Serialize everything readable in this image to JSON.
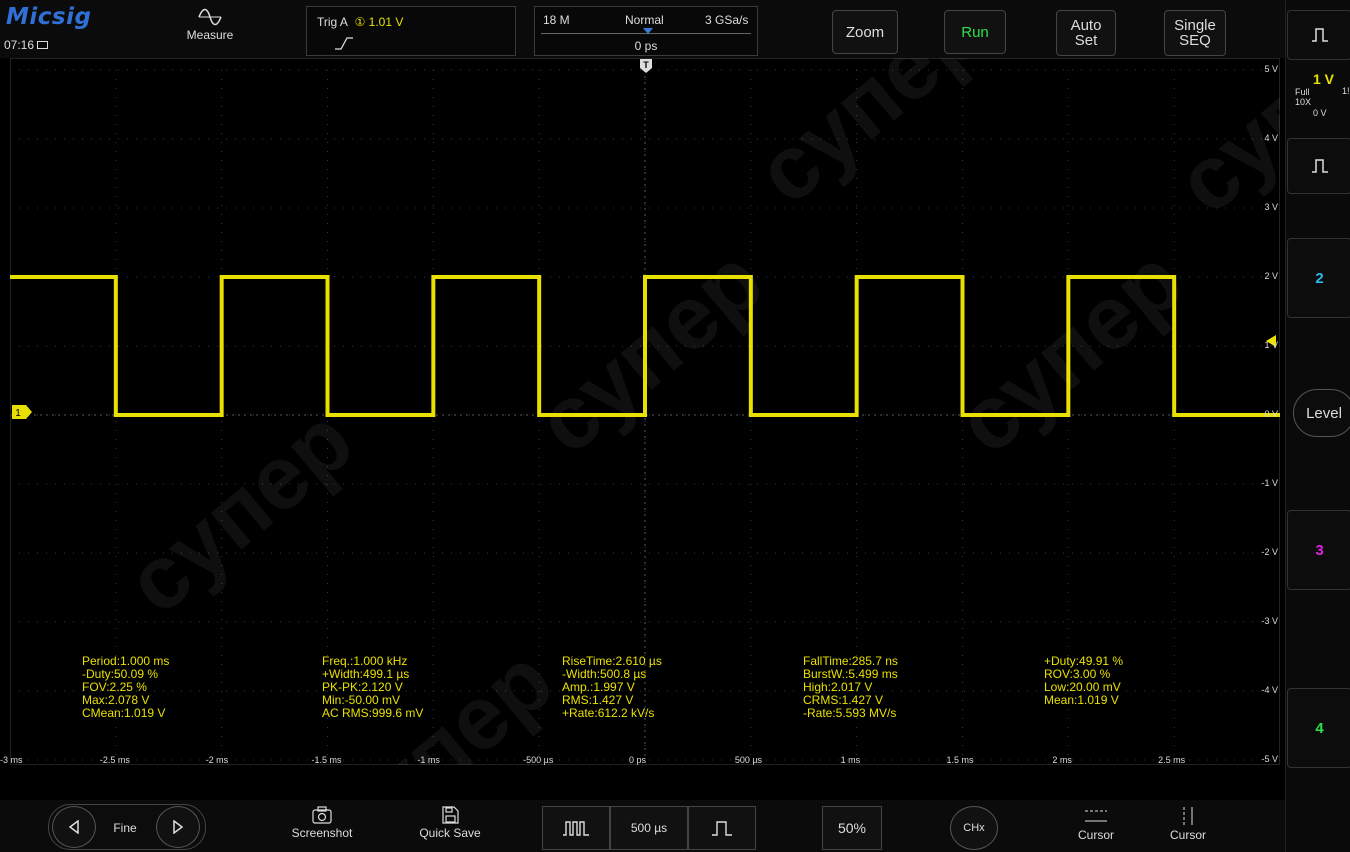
{
  "header": {
    "logo": "Micsig",
    "clock": "07:16",
    "measure_label": "Measure",
    "trigger": {
      "prefix": "Trig A",
      "channel_level": "① 1.01 V"
    },
    "acquisition": {
      "memory": "18 M",
      "mode": "Normal",
      "sample_rate": "3 GSa/s",
      "position": "0 ps"
    },
    "buttons": {
      "zoom": "Zoom",
      "run": "Run",
      "autoset_line1": "Auto",
      "autoset_line2": "Set",
      "single_line1": "Single",
      "single_line2": "SEQ"
    }
  },
  "scope": {
    "y_labels": [
      "5 V",
      "4 V",
      "3 V",
      "2 V",
      "1 V",
      "0 V",
      "-1 V",
      "-2 V",
      "-3 V",
      "-4 V",
      "-5 V"
    ],
    "x_labels": [
      "-3 ms",
      "-2.5 ms",
      "-2 ms",
      "-1.5 ms",
      "-1 ms",
      "-500 µs",
      "0 ps",
      "500 µs",
      "1 ms",
      "1.5 ms",
      "2 ms",
      "2.5 ms"
    ],
    "channel_marker": "1",
    "trigger_marker": "T",
    "waveform": {
      "period_ms": 1.0,
      "high_v": 2.0,
      "low_v": 0.0,
      "color": "#e8e000"
    }
  },
  "measurements": [
    [
      "Period:1.000 ms",
      "-Duty:50.09 %",
      "FOV:2.25 %",
      "Max:2.078 V",
      "CMean:1.019 V"
    ],
    [
      "Freq.:1.000 kHz",
      "+Width:499.1 µs",
      "PK-PK:2.120 V",
      "Min:-50.00 mV",
      "AC RMS:999.6 mV"
    ],
    [
      "RiseTime:2.610 µs",
      "-Width:500.8 µs",
      "Amp.:1.997 V",
      "RMS:1.427 V",
      "+Rate:612.2 kV/s"
    ],
    [
      "FallTime:285.7 ns",
      "BurstW.:5.499 ms",
      "High:2.017 V",
      "CRMS:1.427 V",
      "-Rate:5.593 MV/s"
    ],
    [
      "+Duty:49.91 %",
      "ROV:3.00 %",
      "Low:20.00 mV",
      "Mean:1.019 V"
    ]
  ],
  "right_panel": {
    "ch1": {
      "scale": "1 V",
      "bw": "Full",
      "probe": "10X",
      "offset": "0 V",
      "extra_fragment": "1!"
    },
    "ch2": "2",
    "ch3": "3",
    "ch4": "4",
    "level": "Level",
    "colors": {
      "ch1": "#e8e000",
      "ch2": "#2fb8e8",
      "ch3": "#e020e0",
      "ch4": "#2ee04a"
    }
  },
  "footer": {
    "fine": "Fine",
    "screenshot": "Screenshot",
    "quick_save": "Quick Save",
    "timebase": "500 µs",
    "percent": "50%",
    "chx": "CHx",
    "cursor_h": "Cursor",
    "cursor_v": "Cursor"
  },
  "watermark": "супер"
}
